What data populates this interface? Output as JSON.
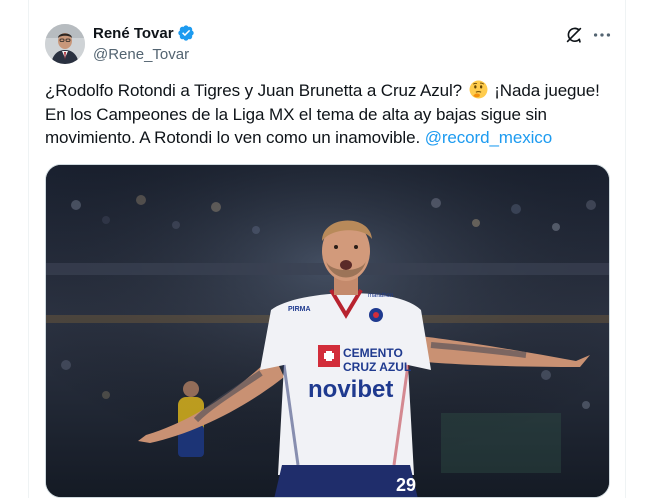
{
  "author": {
    "display_name": "René Tovar",
    "handle": "@Rene_Tovar",
    "verified": true
  },
  "tweet": {
    "line1_before_emoji": "¿Rodolfo Rotondi a Tigres y Juan Brunetta a Cruz Azul?",
    "line1_after_emoji": "¡Nada juegue!",
    "body": "En los Campeones de la Liga MX el tema de alta ay bajas sigue sin movimiento. A Rotondi lo ven como un inamovible.",
    "mention": "@record_mexico",
    "emoji": "thinking-face"
  },
  "media": {
    "jersey_sponsor_1": "CEMENTO",
    "jersey_sponsor_2": "CRUZ AZUL",
    "jersey_sponsor_3": "novibet",
    "jersey_number": "29",
    "jersey_maker": "PIRMA",
    "jersey_sleeve": "marathon"
  },
  "icons": {
    "grok": "grok-icon",
    "more": "more-icon",
    "verified": "verified-badge-icon"
  },
  "colors": {
    "text": "#0f1419",
    "secondary": "#536471",
    "link": "#1d9bf0",
    "verified": "#1d9bf0"
  }
}
